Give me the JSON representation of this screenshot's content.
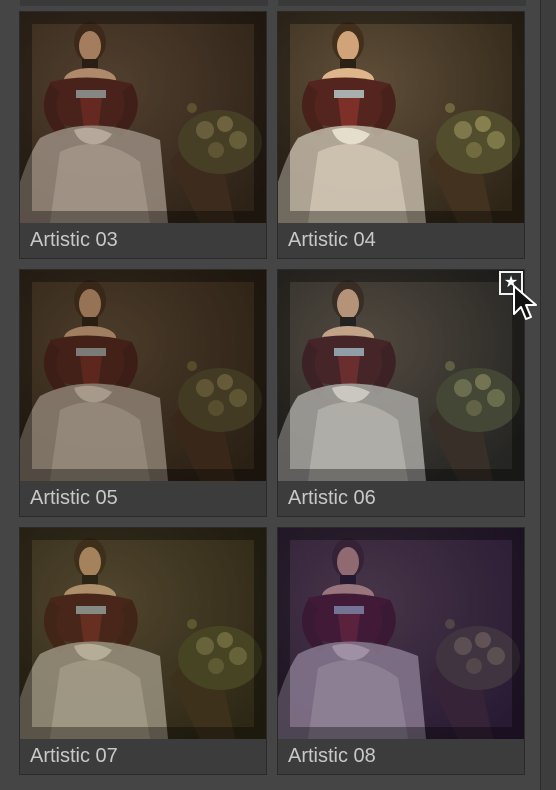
{
  "presets": [
    {
      "label": "Artistic 03",
      "tint": "#7a5a38",
      "tint_opacity": 0.28,
      "bright": 0.9
    },
    {
      "label": "Artistic 04",
      "tint": "#8a7040",
      "tint_opacity": 0.22,
      "bright": 1.15
    },
    {
      "label": "Artistic 05",
      "tint": "#6a5030",
      "tint_opacity": 0.3,
      "bright": 0.85
    },
    {
      "label": "Artistic 06",
      "tint": "#5a6868",
      "tint_opacity": 0.25,
      "bright": 1.05
    },
    {
      "label": "Artistic 07",
      "tint": "#6a6030",
      "tint_opacity": 0.32,
      "bright": 0.95
    },
    {
      "label": "Artistic 08",
      "tint": "#4a3070",
      "tint_opacity": 0.4,
      "bright": 0.95
    }
  ],
  "favorite_icon": "star-icon",
  "cursor_icon": "arrow-cursor-icon"
}
